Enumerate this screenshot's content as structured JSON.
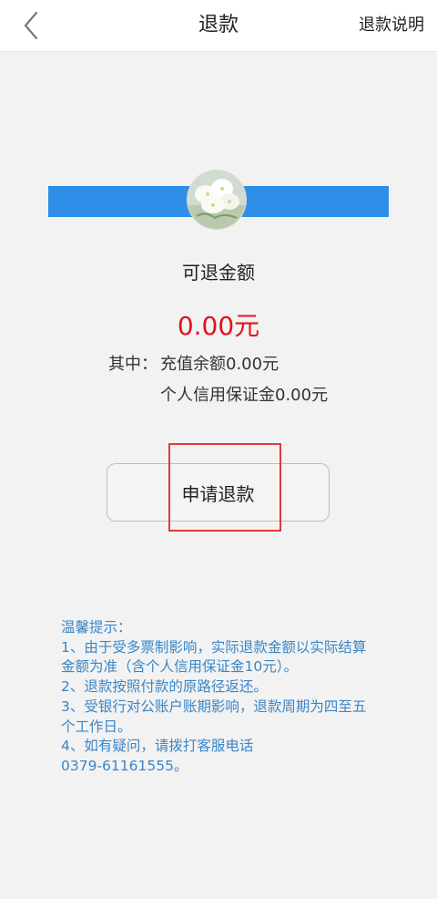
{
  "header": {
    "title": "退款",
    "right_link": "退款说明"
  },
  "colors": {
    "accent_bar": "#2f8ee8",
    "amount": "#e4121e",
    "tips": "#3a86c8",
    "highlight": "#e23a3a"
  },
  "refund": {
    "label": "可退金额",
    "amount": "0.00元",
    "breakdown_prefix": "其中：",
    "recharge_balance": "充值余额0.00元",
    "credit_deposit": "个人信用保证金0.00元"
  },
  "button": {
    "label": "申请退款"
  },
  "tips": {
    "lines": [
      "温馨提示：",
      "1、由于受多票制影响，实际退款金额以实际结算",
      "金额为准（含个人信用保证金10元）。",
      "2、退款按照付款的原路径返还。",
      "3、受银行对公账户账期影响，退款周期为四至五",
      "个工作日。",
      "4、如有疑问，请拨打客服电话",
      "0379-61161555。"
    ]
  }
}
